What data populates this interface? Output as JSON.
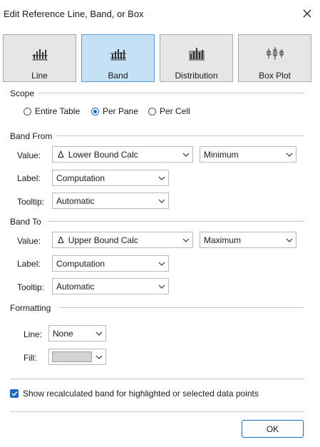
{
  "window": {
    "title": "Edit Reference Line, Band, or Box",
    "close_icon": "close-icon"
  },
  "types": [
    {
      "label": "Line",
      "icon": "line-chart-icon",
      "selected": false
    },
    {
      "label": "Band",
      "icon": "band-chart-icon",
      "selected": true
    },
    {
      "label": "Distribution",
      "icon": "distribution-chart-icon",
      "selected": false
    },
    {
      "label": "Box Plot",
      "icon": "box-plot-icon",
      "selected": false
    }
  ],
  "scope": {
    "title": "Scope",
    "options": [
      {
        "label": "Entire Table",
        "checked": false
      },
      {
        "label": "Per Pane",
        "checked": true
      },
      {
        "label": "Per Cell",
        "checked": false
      }
    ]
  },
  "band_from": {
    "title": "Band From",
    "value_label": "Value:",
    "value_field": "Lower Bound Calc",
    "value_agg": "Minimum",
    "label_label": "Label:",
    "label_value": "Computation",
    "tooltip_label": "Tooltip:",
    "tooltip_value": "Automatic"
  },
  "band_to": {
    "title": "Band To",
    "value_label": "Value:",
    "value_field": "Upper Bound Calc",
    "value_agg": "Maximum",
    "label_label": "Label:",
    "label_value": "Computation",
    "tooltip_label": "Tooltip:",
    "tooltip_value": "Automatic"
  },
  "formatting": {
    "title": "Formatting",
    "line_label": "Line:",
    "line_value": "None",
    "fill_label": "Fill:",
    "fill_color": "#d3d3d3"
  },
  "recalc": {
    "label": "Show recalculated band for highlighted or selected data points",
    "checked": true
  },
  "ok_label": "OK",
  "colors": {
    "accent": "#1b6ac2",
    "selected_bg": "#c5e1f6",
    "button_bg": "#e6e6e6"
  }
}
